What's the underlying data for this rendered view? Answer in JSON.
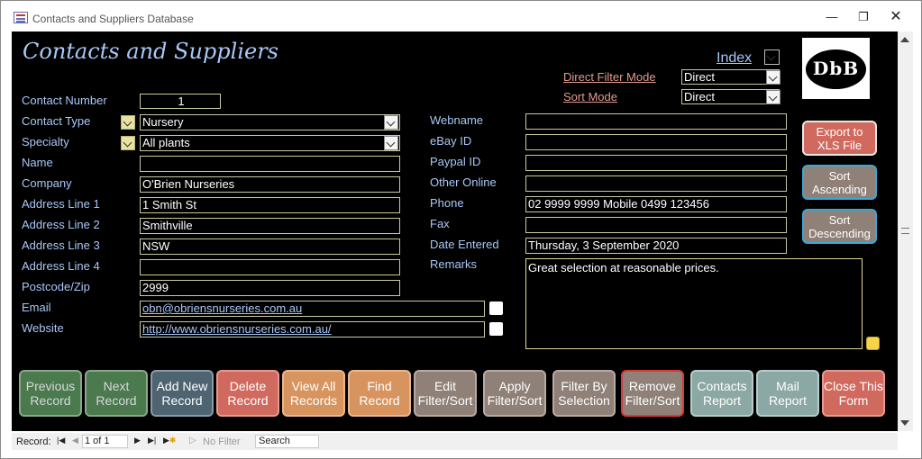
{
  "window": {
    "title": "Contacts and Suppliers Database"
  },
  "form": {
    "heading": "Contacts and Suppliers",
    "logo_text": "DbB",
    "index_label": "Index",
    "direct_filter_label": "Direct Filter Mode",
    "direct_filter_value": "Direct",
    "sort_mode_label": "Sort Mode",
    "sort_mode_value": "Direct",
    "fields_left": {
      "contact_number": {
        "label": "Contact Number",
        "value": "1"
      },
      "contact_type": {
        "label": "Contact Type",
        "value": "Nursery"
      },
      "specialty": {
        "label": "Specialty",
        "value": "All plants"
      },
      "name": {
        "label": "Name",
        "value": ""
      },
      "company": {
        "label": "Company",
        "value": "O'Brien Nurseries"
      },
      "address1": {
        "label": "Address Line 1",
        "value": "1 Smith St"
      },
      "address2": {
        "label": "Address Line 2",
        "value": "Smithville"
      },
      "address3": {
        "label": "Address Line 3",
        "value": "NSW"
      },
      "address4": {
        "label": "Address Line 4",
        "value": ""
      },
      "postcode": {
        "label": "Postcode/Zip",
        "value": "2999"
      },
      "email": {
        "label": "Email",
        "value": "obn@obriensnurseries.com.au"
      },
      "website": {
        "label": "Website",
        "value": "http://www.obriensnurseries.com.au/"
      }
    },
    "fields_right": {
      "webname": {
        "label": "Webname",
        "value": ""
      },
      "ebay_id": {
        "label": "eBay ID",
        "value": ""
      },
      "paypal_id": {
        "label": "Paypal ID",
        "value": ""
      },
      "other_online": {
        "label": "Other Online",
        "value": ""
      },
      "phone": {
        "label": "Phone",
        "value": "02 9999 9999 Mobile 0499 123456"
      },
      "fax": {
        "label": "Fax",
        "value": ""
      },
      "date_entered": {
        "label": "Date Entered",
        "value": "Thursday, 3 September 2020"
      },
      "remarks": {
        "label": "Remarks",
        "value": "Great selection at reasonable prices."
      }
    },
    "right_buttons": {
      "export": "Export to XLS File",
      "sort_asc": "Sort Ascending",
      "sort_desc": "Sort Descending"
    },
    "bottom_buttons": {
      "previous": "Previous Record",
      "next": "Next Record",
      "add_new": "Add New Record",
      "delete": "Delete Record",
      "view_all": "View All Records",
      "find": "Find Record",
      "edit_filter": "Edit Filter/Sort",
      "apply_filter": "Apply Filter/Sort",
      "filter_selection": "Filter By Selection",
      "remove_filter": "Remove Filter/Sort",
      "contacts_report": "Contacts Report",
      "mail_report": "Mail Report",
      "close_form": "Close This Form"
    }
  },
  "navigation": {
    "record_label": "Record:",
    "position": "1 of 1",
    "filter_status": "No Filter",
    "search_placeholder": "Search"
  },
  "colors": {
    "form_background": "#000000",
    "label_blue": "#a9c8f7",
    "heading_blue": "#a9c8f7",
    "link_salmon": "#e09a8e",
    "green_button": "#4a7a4e",
    "slate_button": "#4e6470",
    "red_button": "#d06a5e",
    "orange_button": "#d8945e",
    "taupe_button": "#8f8078",
    "teal_button": "#8ba8a4"
  }
}
